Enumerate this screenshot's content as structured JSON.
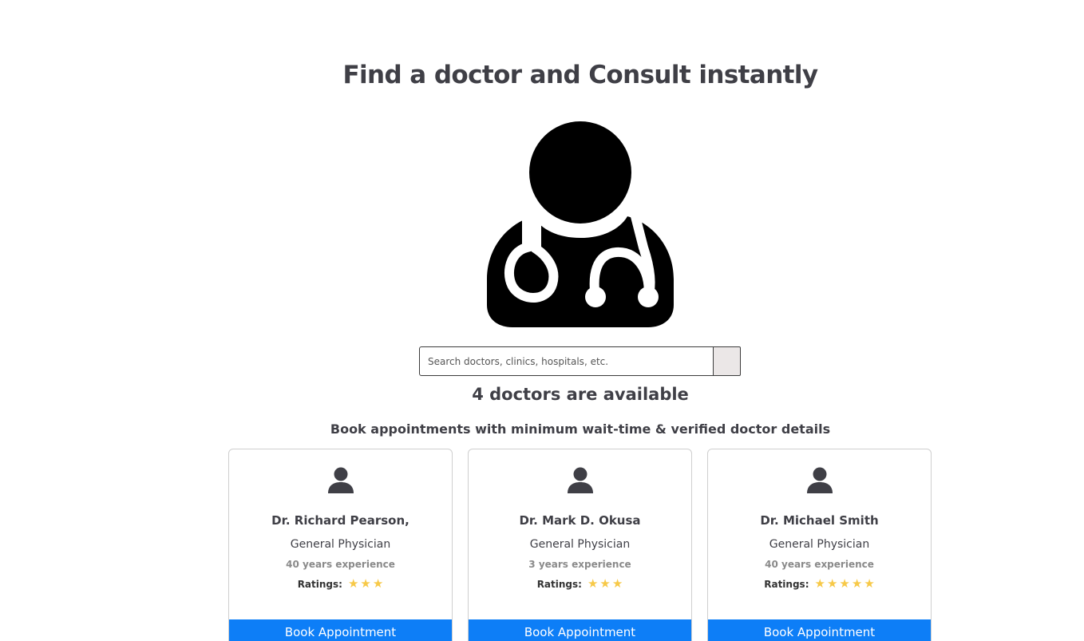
{
  "page_title": "Find a doctor and Consult instantly",
  "hero_icon": "doctor-stethoscope-icon",
  "search": {
    "placeholder": "Search doctors, clinics, hospitals, etc.",
    "value": ""
  },
  "count_heading": "4 doctors are available",
  "sub_heading": "Book appointments with minimum wait-time & verified doctor details",
  "ratings_label": "Ratings:",
  "star_color": "#f7c948",
  "button_color": "#0d7ef7",
  "doctors": [
    {
      "name": "Dr. Richard Pearson,",
      "specialty": "General Physician",
      "experience": "40 years experience",
      "rating": 3,
      "button_label": "Book Appointment"
    },
    {
      "name": "Dr. Mark D. Okusa",
      "specialty": "General Physician",
      "experience": "3 years experience",
      "rating": 3,
      "button_label": "Book Appointment"
    },
    {
      "name": "Dr. Michael Smith",
      "specialty": "General Physician",
      "experience": "40 years experience",
      "rating": 5,
      "button_label": "Book Appointment"
    }
  ]
}
